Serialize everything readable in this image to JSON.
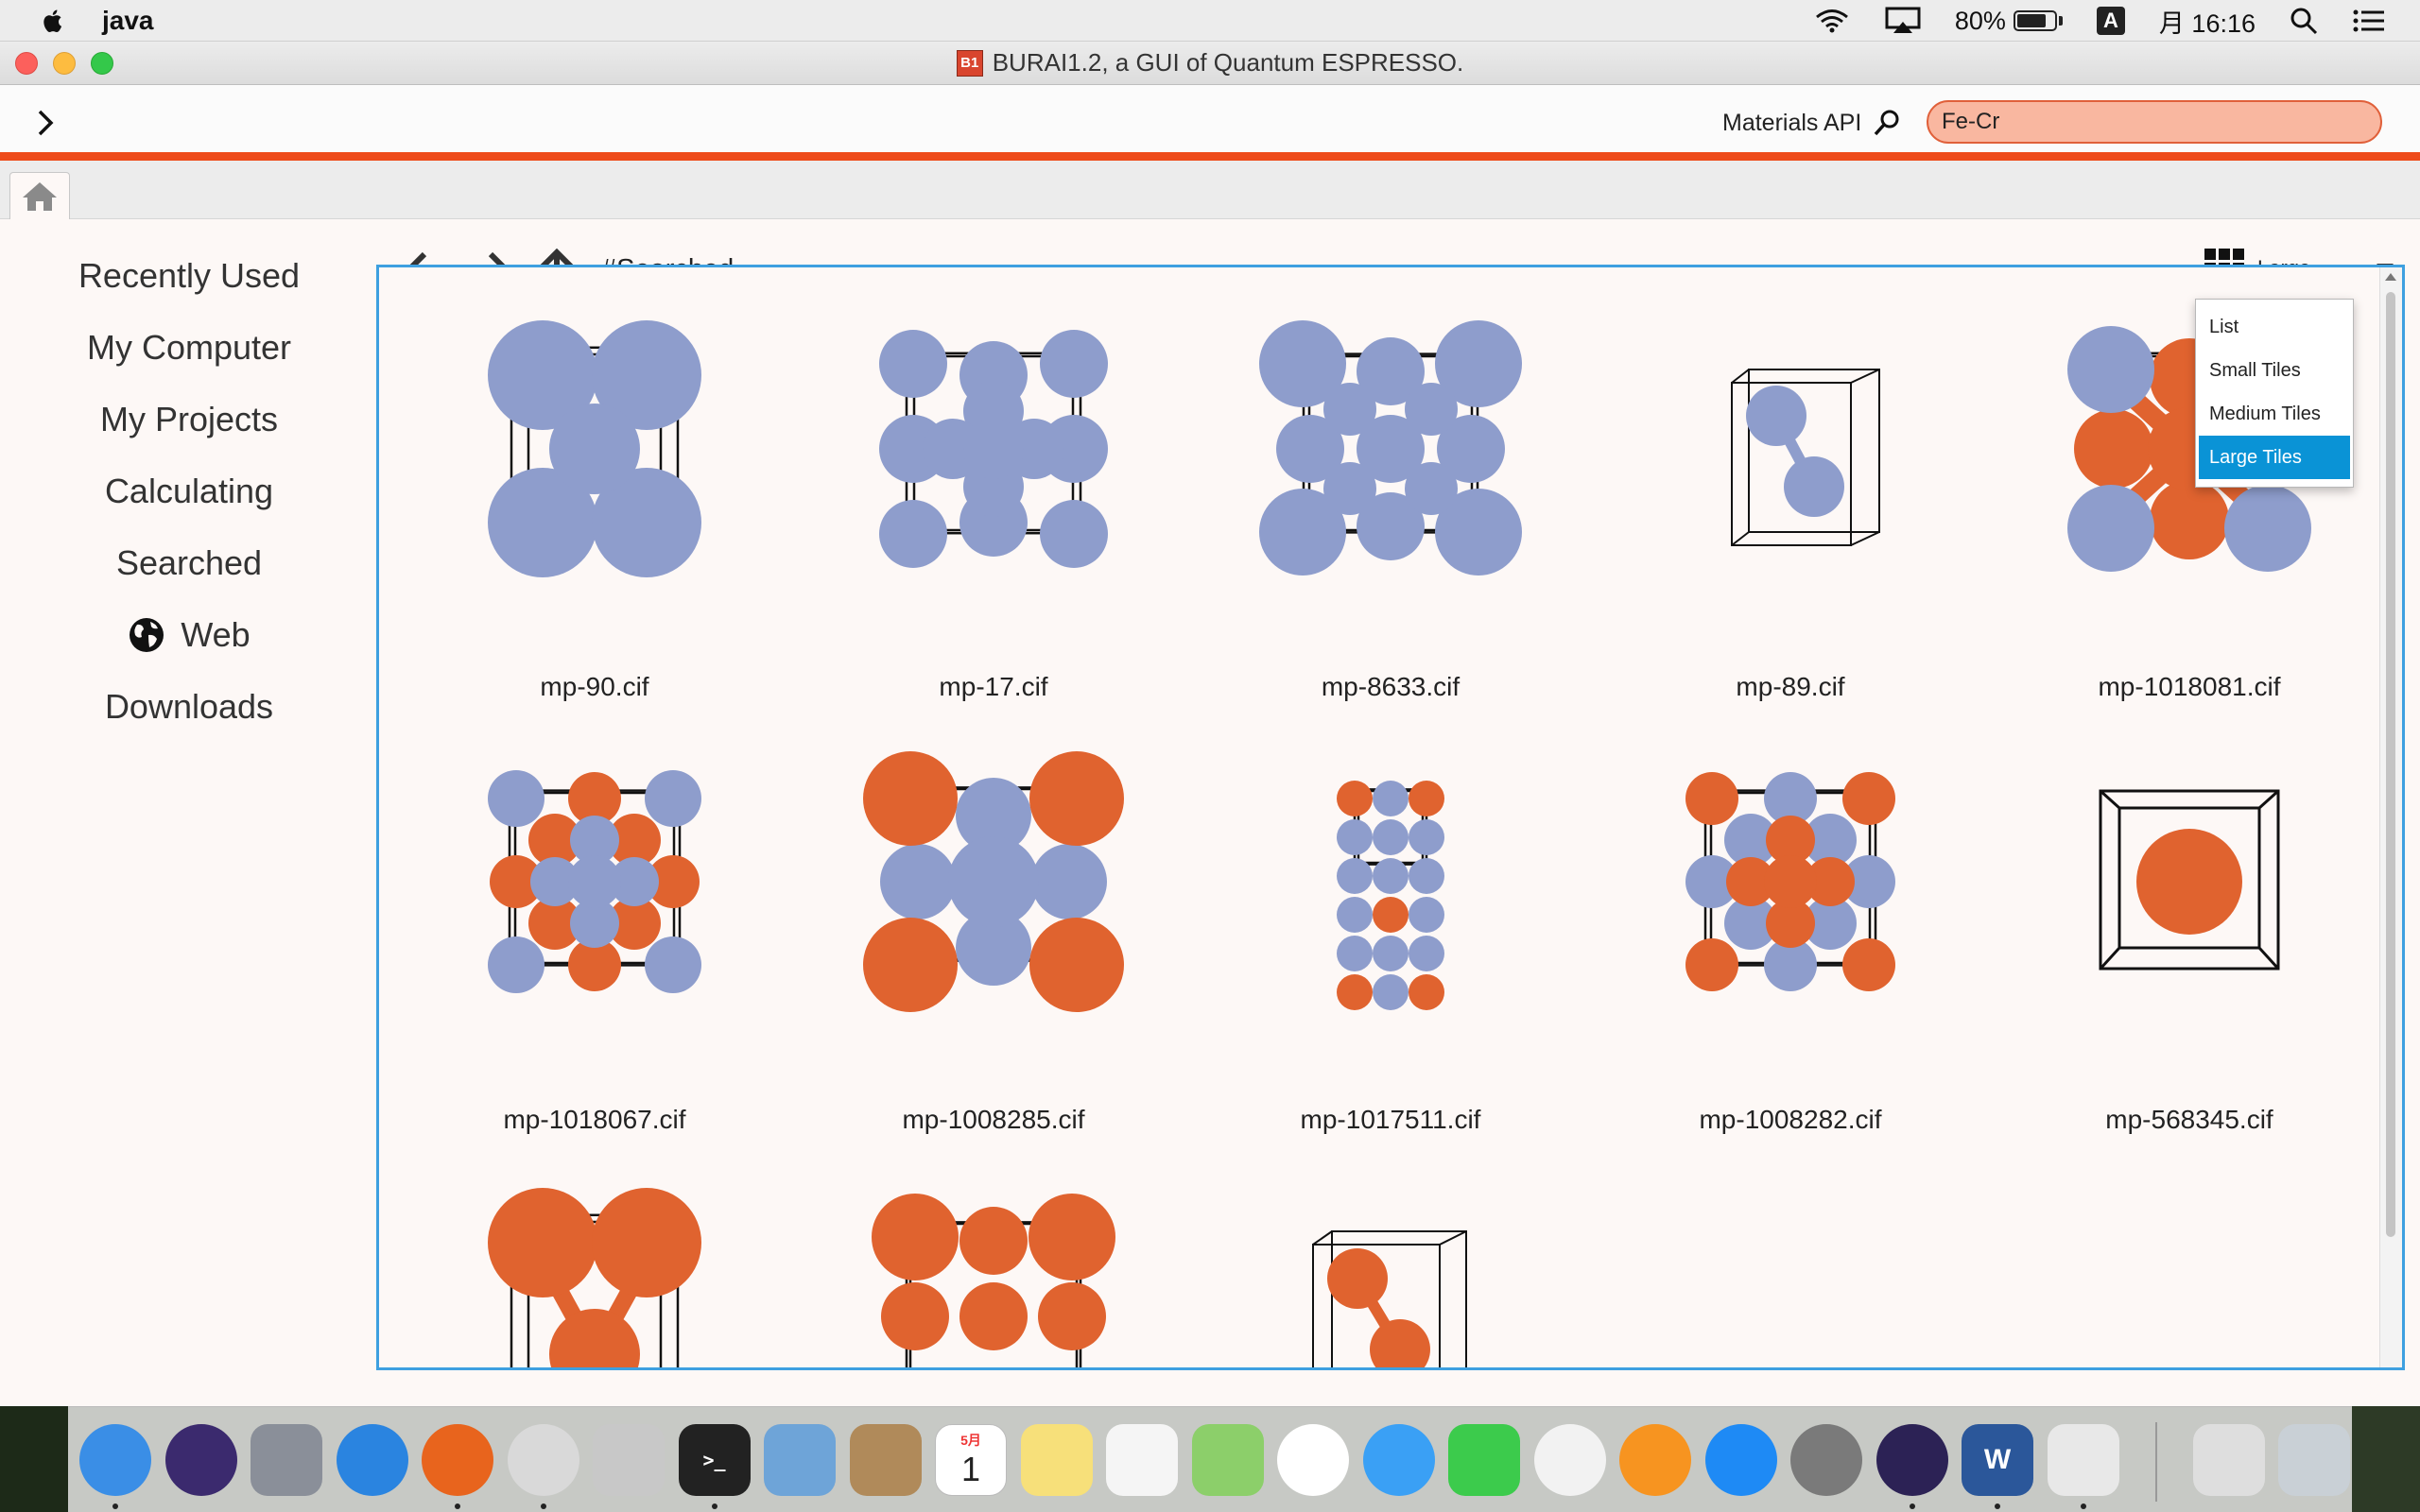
{
  "menubar": {
    "app_name": "java",
    "battery_percent": "80%",
    "battery_level": 0.8,
    "ime": "A",
    "clock": "月 16:16"
  },
  "window": {
    "title": "BURAI1.2, a GUI of Quantum ESPRESSO.",
    "title_icon_text": "B1"
  },
  "toolbar": {
    "api_label": "Materials API",
    "search_value": "Fe-Cr",
    "accent_color": "#ee4b1a"
  },
  "sidebar": {
    "items": [
      {
        "label": "Recently Used"
      },
      {
        "label": "My Computer"
      },
      {
        "label": "My Projects"
      },
      {
        "label": "Calculating"
      },
      {
        "label": "Searched"
      },
      {
        "label": "Web",
        "icon": "globe-icon"
      },
      {
        "label": "Downloads"
      }
    ]
  },
  "nav": {
    "breadcrumb": "#Searched",
    "view_mode": "Large"
  },
  "view_menu": {
    "options": [
      "List",
      "Small Tiles",
      "Medium Tiles",
      "Large Tiles"
    ],
    "selected": "Large Tiles"
  },
  "colors": {
    "fe_atom": "#8e9dcc",
    "cr_atom": "#e0632f",
    "selection": "#0a93d6",
    "content_border": "#3ea0e0"
  },
  "files": [
    {
      "name": "mp-90.cif"
    },
    {
      "name": "mp-17.cif"
    },
    {
      "name": "mp-8633.cif"
    },
    {
      "name": "mp-89.cif"
    },
    {
      "name": "mp-1018081.cif"
    },
    {
      "name": "mp-1018067.cif"
    },
    {
      "name": "mp-1008285.cif"
    },
    {
      "name": "mp-1017511.cif"
    },
    {
      "name": "mp-1008282.cif"
    },
    {
      "name": "mp-568345.cif"
    },
    {
      "name": ""
    },
    {
      "name": ""
    },
    {
      "name": ""
    }
  ],
  "dock": {
    "apps": [
      "finder-icon",
      "siri-icon",
      "launchpad-icon",
      "safari-icon",
      "firefox-icon",
      "chrome-icon",
      "chrome-app-icon",
      "terminal-icon",
      "mail-icon",
      "contacts-icon",
      "calendar-icon",
      "notes-icon",
      "reminders-icon",
      "maps-icon",
      "photos-icon",
      "messages-icon",
      "facetime-icon",
      "itunes-icon",
      "ibooks-icon",
      "appstore-icon",
      "system-preferences-icon",
      "eclipse-icon",
      "word-icon",
      "coffee-icon",
      "preview-icon",
      "trash-icon"
    ],
    "calendar_month": "5月",
    "calendar_day": "1"
  }
}
